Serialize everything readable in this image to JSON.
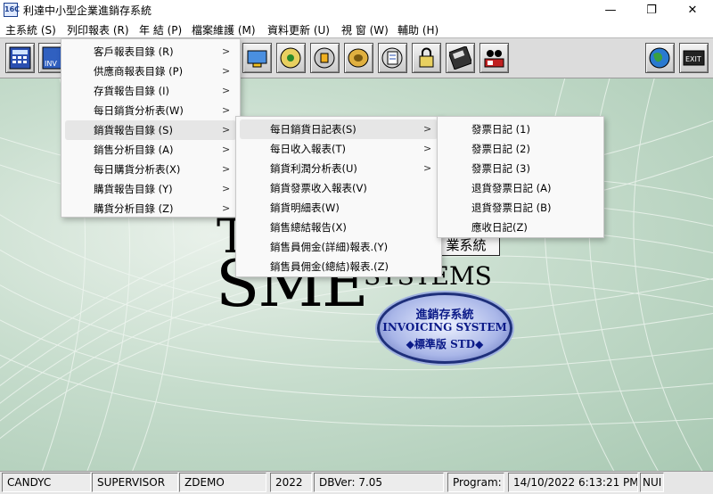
{
  "window": {
    "title": "利達中小型企業進銷存系統",
    "app_icon_text": "16C",
    "minimize": "—",
    "maximize": "❐",
    "close": "✕"
  },
  "menubar": [
    "主系統 (S)",
    "列印報表 (R)",
    "年 結 (P)",
    "檔案維護 (M)",
    "資料更新 (U)",
    "視 窗 (W)",
    "輔助 (H)"
  ],
  "menu_reports": [
    "客戶報表目錄 (R)",
    "供應商報表目錄 (P)",
    "存貨報告目錄 (I)",
    "每日銷貨分析表(W)",
    "銷貨報告目錄 (S)",
    "銷售分析目錄 (A)",
    "每日購貨分析表(X)",
    "購貨報告目錄 (Y)",
    "購貨分析目錄 (Z)"
  ],
  "menu_sales": [
    "每日銷貨日記表(S)",
    "每日收入報表(T)",
    "銷貨利潤分析表(U)",
    "銷貨發票收入報表(V)",
    "銷貨明細表(W)",
    "銷售總結報告(X)",
    "銷售員佣金(詳細)報表.(Y)",
    "銷售員佣金(總結)報表.(Z)"
  ],
  "menu_daily": [
    "發票日記 (1)",
    "發票日記 (2)",
    "發票日記 (3)",
    "退貨發票日記 (A)",
    "退貨發票日記 (B)",
    "應收日記(Z)"
  ],
  "submenu_arrow": ">",
  "logo": {
    "t": "T",
    "sme": "SME",
    "systems": "SYSTEMS",
    "box_text": "業系統",
    "badge_line1": "進銷存系統",
    "badge_line2": "INVOICING SYSTEM",
    "badge_line3": "◆標準版 STD◆"
  },
  "toolbar_labels": {
    "inv": "INV",
    "exit": "EXIT"
  },
  "status": {
    "user": "CANDYC",
    "role": "SUPERVISOR",
    "company": "ZDEMO",
    "year": "2022",
    "dbver": "DBVer: 7.05",
    "program": "Program: ",
    "datetime": "14/10/2022 6:13:21 PM",
    "mode": "NUI"
  }
}
